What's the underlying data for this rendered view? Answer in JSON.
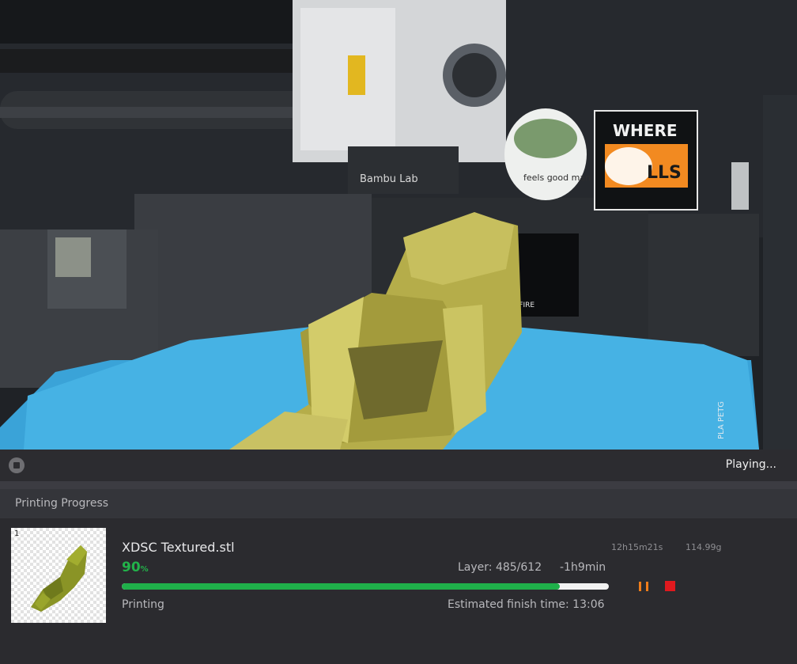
{
  "camera": {
    "status": "Playing...",
    "view_labels": {
      "printer_brand": "Bambu Lab",
      "sticker_top": "WHERE",
      "sticker_bottom": "LLS",
      "frog_sticker": "feels good man",
      "flag_text": "NT  T THE FIRE",
      "plate_text": "PLA  PETG"
    }
  },
  "progress": {
    "section_title": "Printing Progress",
    "thumbnail_index": "1",
    "filename": "XDSC Textured.stl",
    "duration": "12h15m21s",
    "weight": "114.99g",
    "percent_value": "90",
    "percent_unit": "%",
    "percent_fraction": 0.9,
    "layer": "Layer: 485/612",
    "remaining": "-1h9min",
    "status": "Printing",
    "finish_time": "Estimated finish time: 13:06"
  },
  "colors": {
    "progress_green": "#1fb04a",
    "pause_orange": "#f07d1a",
    "stop_red": "#e0191e",
    "bed_blue": "#3aa3d8"
  },
  "icons": {
    "camera_stop": "stop-circle-icon",
    "pause": "pause-icon",
    "stop": "stop-square-icon"
  }
}
